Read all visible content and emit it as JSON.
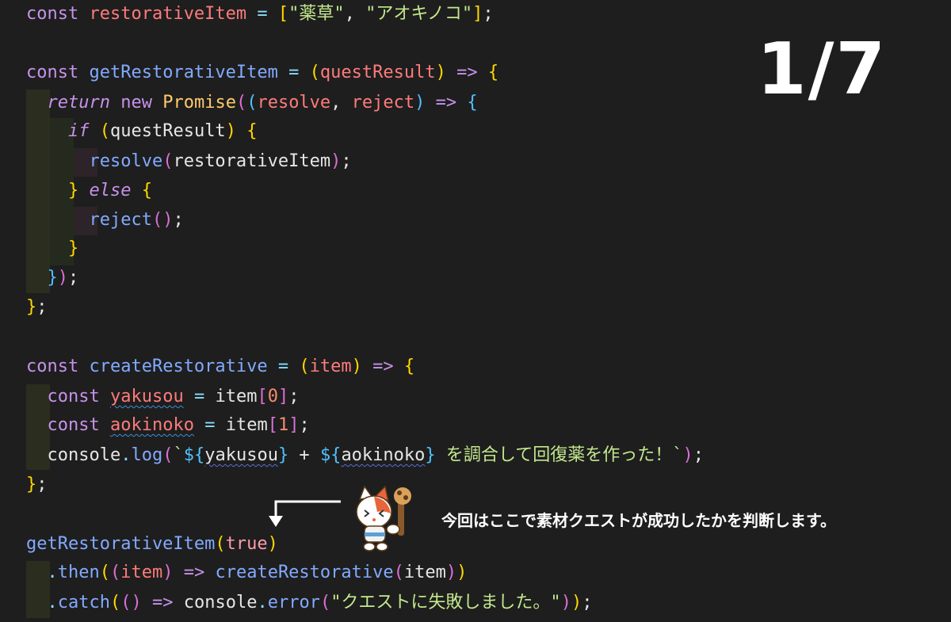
{
  "code": {
    "l1": {
      "kw": "const",
      "name": "restorativeItem",
      "eq": "=",
      "ob": "[",
      "s1": "\"薬草\"",
      "comma": ",",
      "s2": "\"アオキノコ\"",
      "cb": "]",
      "semi": ";"
    },
    "l3": {
      "kw": "const",
      "name": "getRestorativeItem",
      "eq": "=",
      "op": "(",
      "param": "questResult",
      "cp": ")",
      "arrow": "=>",
      "brace": "{"
    },
    "l4": {
      "ret": "return",
      "nw": "new",
      "cls": "Promise",
      "op1": "(",
      "op2": "(",
      "p1": "resolve",
      "comma": ",",
      "p2": "reject",
      "cp": ")",
      "arrow": "=>",
      "brace": "{"
    },
    "l5": {
      "kw": "if",
      "op": "(",
      "arg": "questResult",
      "cp": ")",
      "brace": "{"
    },
    "l6": {
      "fn": "resolve",
      "op": "(",
      "arg": "restorativeItem",
      "cp": ")",
      "semi": ";"
    },
    "l7": {
      "brace": "}",
      "kw": "else",
      "brace2": "{"
    },
    "l8": {
      "fn": "reject",
      "op": "(",
      "cp": ")",
      "semi": ";"
    },
    "l9": {
      "brace": "}"
    },
    "l10": {
      "brace": "}",
      "paren": ")",
      "semi": ";"
    },
    "l11": {
      "brace": "}",
      "semi": ";"
    },
    "l13": {
      "kw": "const",
      "name": "createRestorative",
      "eq": "=",
      "op": "(",
      "param": "item",
      "cp": ")",
      "arrow": "=>",
      "brace": "{"
    },
    "l14": {
      "kw": "const",
      "name": "yakusou",
      "eq": "=",
      "obj": "item",
      "ob": "[",
      "idx": "0",
      "cb": "]",
      "semi": ";"
    },
    "l15": {
      "kw": "const",
      "name": "aokinoko",
      "eq": "=",
      "obj": "item",
      "ob": "[",
      "idx": "1",
      "cb": "]",
      "semi": ";"
    },
    "l16": {
      "obj": "console",
      "dot": ".",
      "fn": "log",
      "op": "(",
      "tick": "`",
      "d1": "${",
      "v1": "yakusou",
      "c1": "}",
      "plus": " + ",
      "d2": "${",
      "v2": "aokinoko",
      "c2": "}",
      "tail": " を調合して回復薬を作った！",
      "tick2": "`",
      "cp": ")",
      "semi": ";"
    },
    "l17": {
      "brace": "}",
      "semi": ";"
    },
    "l19": {
      "fn": "getRestorativeItem",
      "op": "(",
      "arg": "true",
      "cp": ")"
    },
    "l20": {
      "dot": ".",
      "fn": "then",
      "op1": "(",
      "op2": "(",
      "p": "item",
      "cp": ")",
      "arrow": "=>",
      "fn2": "createRestorative",
      "op3": "(",
      "arg": "item",
      "cp2": ")",
      "cp3": ")"
    },
    "l21": {
      "dot": ".",
      "fn": "catch",
      "op1": "(",
      "op2": "(",
      "cp": ")",
      "arrow": "=>",
      "obj": "console",
      "dot2": ".",
      "fn2": "error",
      "op3": "(",
      "str": "\"クエストに失敗しました。\"",
      "cp2": ")",
      "cp3": ")",
      "semi": ";"
    }
  },
  "page_counter": "1/7",
  "caption": "今回はここで素材クエストが成功したかを判断します。",
  "mascot": {
    "icon": "felyne-mascot-icon"
  },
  "arrow": {
    "icon": "bent-arrow-down-icon"
  },
  "colors": {
    "background": "#1e1e1e",
    "keyword": "#c792ea",
    "variable": "#ff7b7b",
    "function": "#82aaff",
    "string": "#c3e88d",
    "bracket_gold": "#ffd700",
    "bracket_pink": "#da70d6",
    "bracket_blue": "#4fc1ff"
  }
}
